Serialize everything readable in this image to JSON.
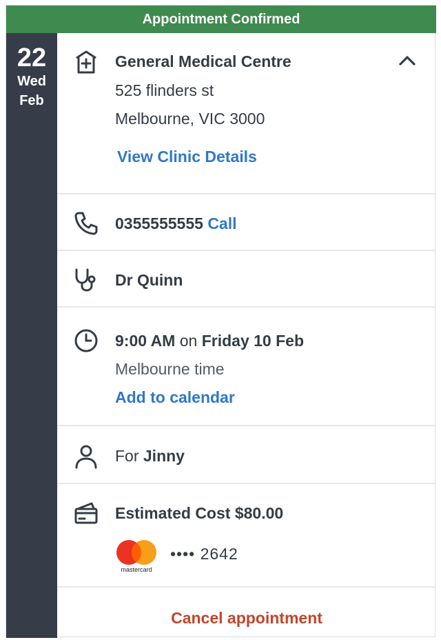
{
  "banner": {
    "title": "Appointment Confirmed"
  },
  "date": {
    "day": "22",
    "weekday": "Wed",
    "month": "Feb"
  },
  "clinic": {
    "name": "General Medical Centre",
    "address_line1": "525 flinders st",
    "address_line2": "Melbourne, VIC 3000",
    "details_link": "View Clinic Details"
  },
  "phone": {
    "number": "0355555555",
    "call_label": "Call"
  },
  "doctor": {
    "name": "Dr Quinn"
  },
  "time": {
    "time": "9:00 AM",
    "connector": "on",
    "date": "Friday 10 Feb",
    "timezone": "Melbourne time",
    "calendar_link": "Add to calendar"
  },
  "patient": {
    "prefix": "For",
    "name": "Jinny"
  },
  "cost": {
    "label": "Estimated Cost",
    "amount": "$80.00",
    "card_brand": "mastercard",
    "card_masked": "•••• 2642"
  },
  "actions": {
    "cancel_label": "Cancel appointment"
  },
  "colors": {
    "banner": "#3f8a4f",
    "sidebar": "#363d48",
    "link": "#2f78c9",
    "cancel": "#c1462c"
  }
}
